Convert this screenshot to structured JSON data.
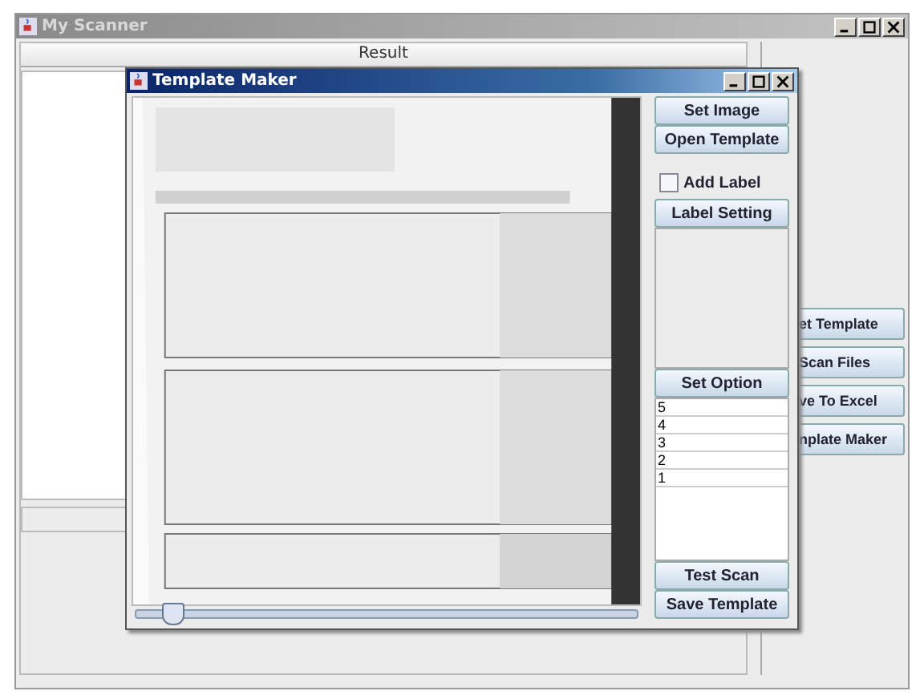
{
  "main_window": {
    "title": "My Scanner",
    "result_header": "Result",
    "buttons": [
      "et Template",
      "Scan Files",
      "ve To Excel",
      "nplate Maker"
    ]
  },
  "dialog": {
    "title": "Template Maker",
    "buttons_top": [
      "Set Image",
      "Open Template"
    ],
    "add_label": {
      "label": "Add Label",
      "checked": false
    },
    "label_setting": "Label Setting",
    "set_option": "Set Option",
    "options": [
      "5",
      "4",
      "3",
      "2",
      "1"
    ],
    "buttons_bottom": [
      "Test Scan",
      "Save Template"
    ],
    "zoom_slider": {
      "level": 0.07
    }
  }
}
